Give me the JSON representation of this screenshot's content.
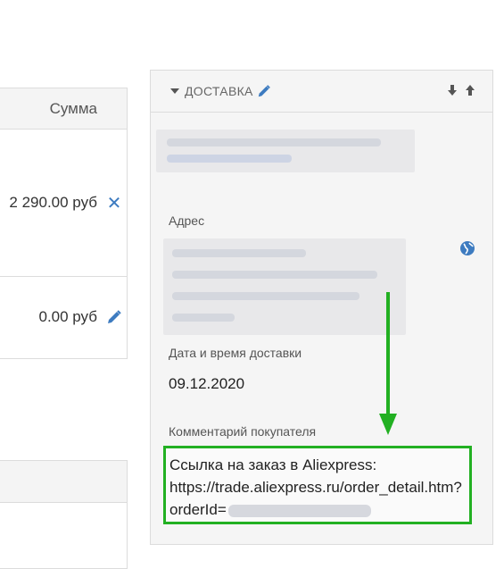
{
  "table": {
    "header_sum": "Сумма",
    "rows": [
      {
        "amount": "2 290.00 руб",
        "action_icon": "close-icon"
      },
      {
        "amount": "0.00 руб",
        "action_icon": "pencil-icon"
      }
    ]
  },
  "delivery": {
    "title": "ДОСТАВКА",
    "address_label": "Адрес",
    "datetime_label": "Дата и время доставки",
    "date_value": "09.12.2020",
    "comment_label": "Комментарий покупателя",
    "comment_line1": "Ссылка на заказ в Aliexpress:",
    "comment_line2": "https://trade.aliexpress.ru/order_detail.htm?",
    "comment_line3_prefix": "orderId="
  },
  "colors": {
    "accent_blue": "#3d7bc0",
    "highlight_green": "#22b022"
  }
}
